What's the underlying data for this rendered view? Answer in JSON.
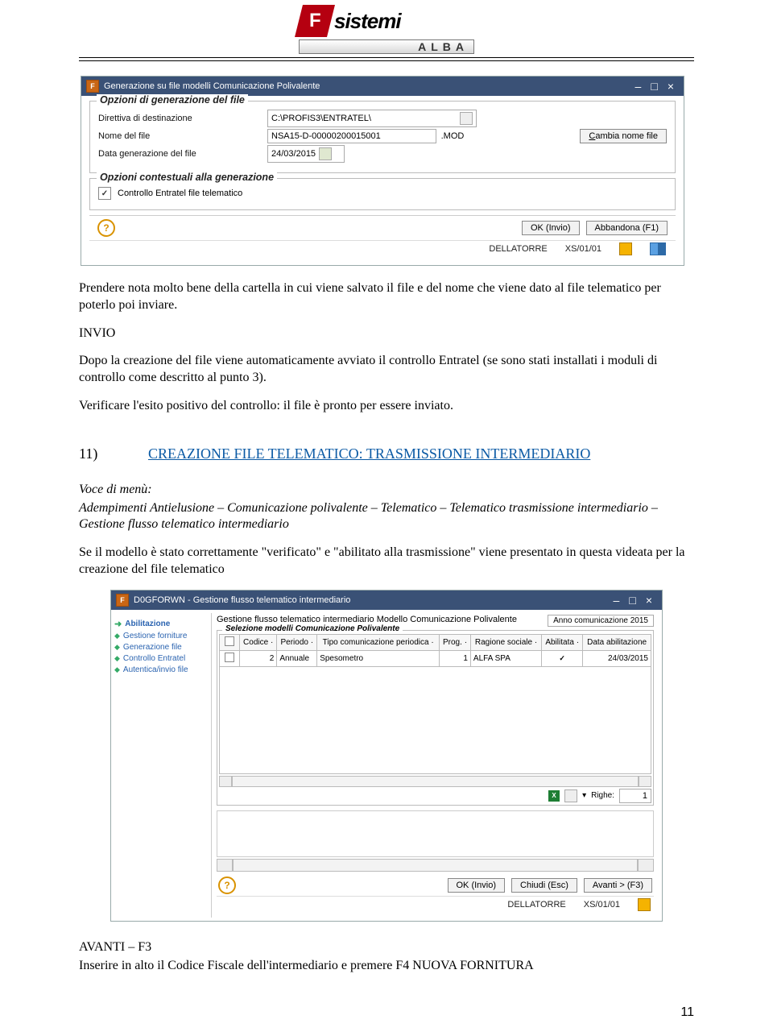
{
  "header": {
    "logo_letter": "F",
    "logo_word": "sistemi",
    "logo_sub": "ALBA"
  },
  "win1": {
    "title": "Generazione su file modelli Comunicazione Polivalente",
    "fs1": {
      "legend": "Opzioni di generazione del file",
      "r1": {
        "label": "Direttiva di destinazione",
        "value": "C:\\PROFIS3\\ENTRATEL\\"
      },
      "r2": {
        "label": "Nome del file",
        "value": "NSA15-D-00000200015001",
        "ext": ".MOD",
        "btn": "Cambia nome file"
      },
      "r3": {
        "label": "Data generazione del file",
        "value": "24/03/2015"
      }
    },
    "fs2": {
      "legend": "Opzioni contestuali alla generazione",
      "chk_label": "Controllo Entratel file telematico"
    },
    "ok": "OK (Invio)",
    "abb": "Abbandona (F1)",
    "st_user": "DELLATORRE",
    "st_code": "XS/01/01"
  },
  "body": {
    "p1": "Prendere nota molto bene della cartella in cui viene salvato il file e del nome che viene dato al file telematico per poterlo poi inviare.",
    "p2a": "INVIO",
    "p2b": "Dopo la creazione del file viene automaticamente avviato il controllo Entratel (se sono stati installati i moduli di controllo come descritto al punto 3).",
    "p3": "Verificare l'esito positivo del controllo: il file è pronto per essere inviato.",
    "sec_num": "11)",
    "sec_title": "CREAZIONE FILE TELEMATICO: TRASMISSIONE INTERMEDIARIO",
    "voce_hdr": "Voce di menù:",
    "voce": "Adempimenti Antielusione – Comunicazione polivalente – Telematico – Telematico trasmissione intermediario – Gestione flusso telematico intermediario",
    "p4": "Se il modello è stato correttamente \"verificato\" e \"abilitato alla trasmissione\" viene presentato in questa videata per la creazione del file telematico",
    "p5": "AVANTI – F3",
    "p6": "Inserire in alto il Codice Fiscale dell'intermediario e premere F4 NUOVA FORNITURA"
  },
  "win2": {
    "title": "D0GFORWN - Gestione flusso telematico intermediario",
    "long": "Gestione flusso telematico intermediario Modello Comunicazione Polivalente",
    "anno": "Anno comunicazione 2015",
    "side": [
      "Abilitazione",
      "Gestione forniture",
      "Generazione file",
      "Controllo Entratel",
      "Autentica/invio file"
    ],
    "fs": "Selezione modelli Comunicazione Polivalente",
    "th": [
      "",
      "Codice",
      "Periodo",
      "Tipo comunicazione periodica",
      "Prog.",
      "Ragione sociale",
      "Abilitata",
      "Data abilitazione"
    ],
    "row": [
      "",
      "2",
      "Annuale",
      "Spesometro",
      "1",
      "ALFA SPA",
      "✓",
      "24/03/2015"
    ],
    "righe_lbl": "Righe:",
    "righe_n": "1",
    "ok": "OK (Invio)",
    "chiudi": "Chiudi (Esc)",
    "avanti": "Avanti > (F3)",
    "st_user": "DELLATORRE",
    "st_code": "XS/01/01"
  },
  "page_number": "11"
}
